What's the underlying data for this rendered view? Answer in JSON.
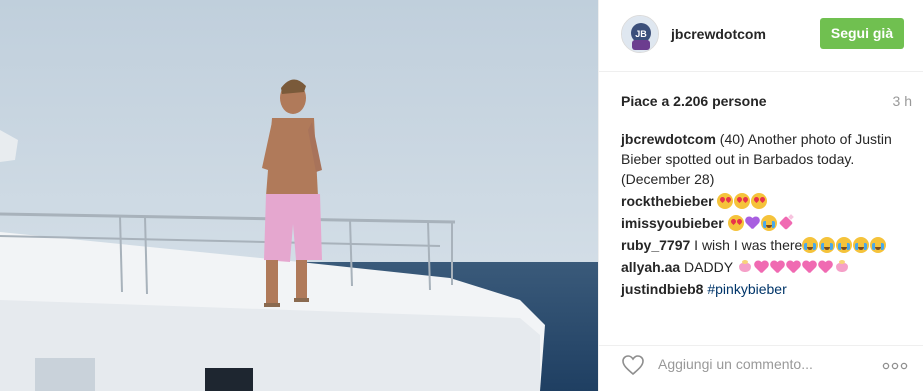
{
  "post": {
    "username": "jbcrewdotcom",
    "follow_label": "Segui già",
    "likes": "Piace a 2.206 persone",
    "time": "3 h",
    "comments": [
      {
        "user": "jbcrewdotcom",
        "text": "(40) Another photo of Justin Bieber spotted out in Barbados today. (December 28)",
        "emojis": []
      },
      {
        "user": "rockthebieber",
        "text": "",
        "emojis": [
          "heart-eyes-emoji",
          "heart-eyes-emoji",
          "heart-eyes-emoji"
        ]
      },
      {
        "user": "imissyoubieber",
        "text": "",
        "emojis": [
          "heart-eyes-emoji",
          "purple-heart-emoji",
          "crying-face-emoji",
          "sparkling-heart-emoji"
        ]
      },
      {
        "user": "ruby_7797",
        "text": "I wish I was there",
        "emojis": [
          "crying-face-emoji",
          "crying-face-emoji",
          "crying-face-emoji",
          "crying-face-emoji",
          "crying-face-emoji"
        ]
      },
      {
        "user": "allyah.aa",
        "text": "DADDY",
        "emojis": [
          "ribbon-emoji",
          "pink-heart-emoji",
          "pink-heart-emoji",
          "pink-heart-emoji",
          "pink-heart-emoji",
          "pink-heart-emoji",
          "ribbon-emoji"
        ]
      },
      {
        "user": "justindbieb8",
        "hashtag": "#pinkybieber",
        "emojis": []
      }
    ],
    "comment_placeholder": "Aggiungi un commento...",
    "icons": {
      "like": "heart-outline-icon",
      "more": "more-options-icon"
    }
  },
  "colors": {
    "follow_button": "#70c050",
    "hashtag": "#003569",
    "muted": "#999999"
  }
}
